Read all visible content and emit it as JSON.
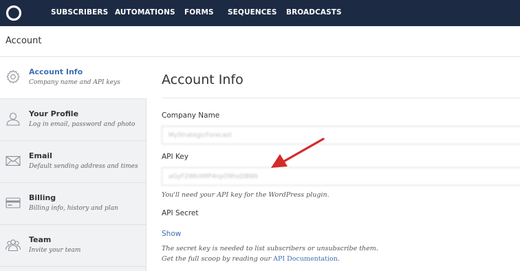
{
  "nav": {
    "items": [
      {
        "label": "SUBSCRIBERS"
      },
      {
        "label": "AUTOMATIONS"
      },
      {
        "label": "FORMS"
      },
      {
        "label": "SEQUENCES"
      },
      {
        "label": "BROADCASTS"
      }
    ]
  },
  "header": {
    "title": "Account"
  },
  "sidebar": {
    "items": [
      {
        "title": "Account Info",
        "subtitle": "Company name and API keys",
        "icon": "gear-icon",
        "active": true
      },
      {
        "title": "Your Profile",
        "subtitle": "Log in email, password and photo",
        "icon": "user-icon"
      },
      {
        "title": "Email",
        "subtitle": "Default sending address and times",
        "icon": "envelope-icon"
      },
      {
        "title": "Billing",
        "subtitle": "Billing info, history and plan",
        "icon": "credit-card-icon"
      },
      {
        "title": "Team",
        "subtitle": "Invite your team",
        "icon": "team-icon"
      }
    ]
  },
  "main": {
    "title": "Account Info",
    "company_name_label": "Company Name",
    "company_name_value": "MyStrategicForecast",
    "api_key_label": "API Key",
    "api_key_value": "aGyF2WbXMP4npO9hxDBWk",
    "api_key_help": "You'll need your API key for the WordPress plugin.",
    "api_secret_label": "API Secret",
    "show_label": "Show",
    "secret_help_1": "The secret key is needed to list subscribers or unsubscribe them.",
    "secret_help_2": "Get the full scoop by reading our",
    "api_doc_link": "API Documentation",
    "period": "."
  },
  "colors": {
    "nav_bg": "#1d2a44",
    "accent": "#3b6fb6",
    "link": "#3f6db0",
    "annotation_arrow": "#d42a2a"
  }
}
